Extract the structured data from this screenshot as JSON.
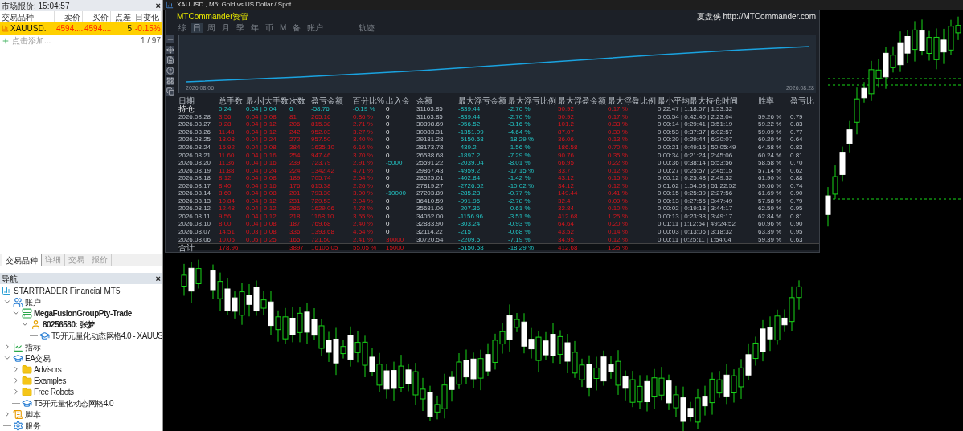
{
  "market_watch": {
    "title": "市场报价: 15:04:57",
    "close": "×",
    "columns": [
      "交易品种",
      "卖价",
      "买价",
      "点差",
      "日变化"
    ],
    "rows": [
      {
        "symbol": "XAUUSD.",
        "bid": "4594....",
        "ask": "4594....",
        "spread": "5",
        "change": "-0.15%",
        "selected": true
      }
    ],
    "add_label": "点击添加...",
    "count": "1 / 97"
  },
  "bottom_tabs": [
    {
      "label": "交易品种",
      "selected": true
    },
    {
      "label": "详细",
      "selected": false
    },
    {
      "label": "交易",
      "selected": false
    },
    {
      "label": "报价",
      "selected": false
    }
  ],
  "navigator": {
    "title": "导航",
    "close": "×",
    "root": "STARTRADER Financial MT5",
    "items": [
      {
        "label": "账户",
        "kind": "accounts",
        "expanded": true,
        "children": [
          {
            "label": "MegaFusionGroupPty-Trade",
            "kind": "server",
            "expanded": true,
            "children": [
              {
                "label": "80256580: 张梦",
                "kind": "user",
                "expanded": true,
                "children": [
                  {
                    "label": "T5开元量化动态网格4.0 - XAUUS",
                    "kind": "ea"
                  }
                ]
              }
            ]
          }
        ]
      },
      {
        "label": "指标",
        "kind": "indicators",
        "expanded": false
      },
      {
        "label": "EA交易",
        "kind": "ea",
        "expanded": true,
        "children": [
          {
            "label": "Advisors",
            "kind": "folder",
            "expanded": false
          },
          {
            "label": "Examples",
            "kind": "folder",
            "expanded": false
          },
          {
            "label": "Free Robots",
            "kind": "folder",
            "expanded": false
          },
          {
            "label": "T5开元量化动态网格4.0",
            "kind": "ea"
          }
        ]
      },
      {
        "label": "脚本",
        "kind": "scripts",
        "expanded": false
      },
      {
        "label": "服务",
        "kind": "services"
      }
    ]
  },
  "chart_window": {
    "title": "XAUUSD., M5: Gold vs US Dollar / Spot"
  },
  "commander": {
    "title": "MTCommander资管",
    "brand": "夏盘侠 http://MTCommander.com",
    "tabs": [
      {
        "label": "综",
        "selected": false
      },
      {
        "label": "日",
        "selected": true
      },
      {
        "label": "周",
        "selected": false
      },
      {
        "label": "月",
        "selected": false
      },
      {
        "label": "季",
        "selected": false
      },
      {
        "label": "年",
        "selected": false
      },
      {
        "label": "币",
        "selected": false
      },
      {
        "label": "M",
        "selected": false
      },
      {
        "label": "备",
        "selected": false
      },
      {
        "label": "账户",
        "selected": false
      },
      {
        "label": "轨迹",
        "selected": false
      }
    ],
    "start_date": "2026.08.06",
    "end_date": "2026.08.28",
    "columns": [
      "日期",
      "总手数",
      "最小|大手数",
      "次数",
      "盈亏金额",
      "百分比%",
      "出入金",
      "余额",
      "最大浮亏金额",
      "最大浮亏比例",
      "最大浮盈金额",
      "最大浮盈比例",
      "最小平均最大持仓时间",
      "胜率",
      "盈亏比"
    ],
    "rows": [
      {
        "kind": "position",
        "d": "持仓",
        "lots": "0.24",
        "mm": "0.04 | 0.04",
        "n": "6",
        "pnl": "-58.76",
        "pct": "-0.19 %",
        "flow": "0",
        "bal": "31163.85",
        "dd": "-839.44",
        "ddp": "-2.70 %",
        "pf": "50.92",
        "pfp": "0.17 %",
        "hold": "0:22:47 | 1:18:07 | 1:53:32"
      },
      {
        "kind": "day",
        "d": "2026.08.28",
        "lots": "3.56",
        "mm": "0.04 | 0.08",
        "n": "81",
        "pnl": "265.16",
        "pct": "0.86 %",
        "flow": "0",
        "bal": "31163.85",
        "dd": "-839.44",
        "ddp": "-2.70 %",
        "pf": "50.92",
        "pfp": "0.17 %",
        "hold": "0:00:54 | 0:42:40 | 2:23:04",
        "win": "59.26 %",
        "plr": "0.79"
      },
      {
        "kind": "day",
        "d": "2026.08.27",
        "lots": "9.28",
        "mm": "0.04 | 0.12",
        "n": "206",
        "pnl": "815.38",
        "pct": "2.71 %",
        "flow": "0",
        "bal": "30898.69",
        "dd": "-956.52",
        "ddp": "-3.16 %",
        "pf": "101.2",
        "pfp": "0.33 %",
        "hold": "0:00:14 | 0:29:41 | 3:51:19",
        "win": "59.22 %",
        "plr": "0.83"
      },
      {
        "kind": "day",
        "d": "2026.08.26",
        "lots": "11.48",
        "mm": "0.04 | 0.12",
        "n": "242",
        "pnl": "952.03",
        "pct": "3.27 %",
        "flow": "0",
        "bal": "30083.31",
        "dd": "-1351.09",
        "ddp": "-4.64 %",
        "pf": "87.07",
        "pfp": "0.30 %",
        "hold": "0:00:53 | 0:37:37 | 6:02:57",
        "win": "59.09 %",
        "plr": "0.77"
      },
      {
        "kind": "day",
        "d": "2026.08.25",
        "lots": "13.08",
        "mm": "0.04 | 0.24",
        "n": "272",
        "pnl": "957.50",
        "pct": "3.40 %",
        "flow": "0",
        "bal": "29131.28",
        "dd": "-5150.58",
        "ddp": "-18.29 %",
        "pf": "36.06",
        "pfp": "0.13 %",
        "hold": "0:00:30 | 0:29:44 | 6:20:07",
        "win": "60.29 %",
        "plr": "0.64"
      },
      {
        "kind": "day",
        "d": "2026.08.24",
        "lots": "15.92",
        "mm": "0.04 | 0.08",
        "n": "384",
        "pnl": "1635.10",
        "pct": "6.16 %",
        "flow": "0",
        "bal": "28173.78",
        "dd": "-439.2",
        "ddp": "-1.56 %",
        "pf": "186.58",
        "pfp": "0.70 %",
        "hold": "0:00:21 | 0:49:16 | 50:05:49",
        "win": "64.58 %",
        "plr": "0.83"
      },
      {
        "kind": "day",
        "d": "2026.08.21",
        "lots": "11.60",
        "mm": "0.04 | 0.16",
        "n": "254",
        "pnl": "947.46",
        "pct": "3.70 %",
        "flow": "0",
        "bal": "26538.68",
        "dd": "-1897.2",
        "ddp": "-7.29 %",
        "pf": "90.76",
        "pfp": "0.35 %",
        "hold": "0:00:34 | 0:21:24 | 2:45:06",
        "win": "60.24 %",
        "plr": "0.81"
      },
      {
        "kind": "day",
        "d": "2026.08.20",
        "lots": "11.36",
        "mm": "0.04 | 0.16",
        "n": "239",
        "pnl": "723.79",
        "pct": "2.91 %",
        "flow": "-5000",
        "bal": "25591.22",
        "dd": "-2039.04",
        "ddp": "-8.01 %",
        "pf": "66.95",
        "pfp": "0.22 %",
        "hold": "0:00:36 | 0:38:14 | 5:53:56",
        "win": "58.58 %",
        "plr": "0.70"
      },
      {
        "kind": "day",
        "d": "2026.08.19",
        "lots": "11.88",
        "mm": "0.04 | 0.24",
        "n": "224",
        "pnl": "1342.42",
        "pct": "4.71 %",
        "flow": "0",
        "bal": "29867.43",
        "dd": "-4959.2",
        "ddp": "-17.15 %",
        "pf": "33.7",
        "pfp": "0.12 %",
        "hold": "0:00:27 | 0:25:57 | 2:45:15",
        "win": "57.14 %",
        "plr": "0.62"
      },
      {
        "kind": "day",
        "d": "2026.08.18",
        "lots": "8.12",
        "mm": "0.04 | 0.08",
        "n": "189",
        "pnl": "705.74",
        "pct": "2.54 %",
        "flow": "0",
        "bal": "28525.01",
        "dd": "-402.84",
        "ddp": "-1.42 %",
        "pf": "43.12",
        "pfp": "0.15 %",
        "hold": "0:00:12 | 0:25:48 | 2:49:32",
        "win": "61.90 %",
        "plr": "0.88"
      },
      {
        "kind": "day",
        "d": "2026.08.17",
        "lots": "8.40",
        "mm": "0.04 | 0.16",
        "n": "176",
        "pnl": "615.38",
        "pct": "2.26 %",
        "flow": "0",
        "bal": "27819.27",
        "dd": "-2726.52",
        "ddp": "-10.02 %",
        "pf": "34.12",
        "pfp": "0.12 %",
        "hold": "0:01:02 | 1:04:03 | 51:22:52",
        "win": "59.66 %",
        "plr": "0.74"
      },
      {
        "kind": "day",
        "d": "2026.08.14",
        "lots": "8.60",
        "mm": "0.04 | 0.08",
        "n": "201",
        "pnl": "793.30",
        "pct": "3.00 %",
        "flow": "-10000",
        "bal": "27203.89",
        "dd": "-285.28",
        "ddp": "-0.77 %",
        "pf": "149.44",
        "pfp": "0.41 %",
        "hold": "0:00:15 | 0:25:39 | 2:27:56",
        "win": "61.69 %",
        "plr": "0.90"
      },
      {
        "kind": "day",
        "d": "2026.08.13",
        "lots": "10.84",
        "mm": "0.04 | 0.12",
        "n": "231",
        "pnl": "729.53",
        "pct": "2.04 %",
        "flow": "0",
        "bal": "36410.59",
        "dd": "-991.96",
        "ddp": "-2.78 %",
        "pf": "32.4",
        "pfp": "0.09 %",
        "hold": "0:00:13 | 0:27:55 | 3:47:49",
        "win": "57.58 %",
        "plr": "0.79"
      },
      {
        "kind": "day",
        "d": "2026.08.12",
        "lots": "12.48",
        "mm": "0.04 | 0.12",
        "n": "286",
        "pnl": "1629.06",
        "pct": "4.78 %",
        "flow": "0",
        "bal": "35681.06",
        "dd": "-207.36",
        "ddp": "-0.61 %",
        "pf": "32.84",
        "pfp": "0.10 %",
        "hold": "0:00:02 | 0:19:13 | 3:44:17",
        "win": "62.59 %",
        "plr": "0.95"
      },
      {
        "kind": "day",
        "d": "2026.08.11",
        "lots": "9.56",
        "mm": "0.04 | 0.12",
        "n": "218",
        "pnl": "1168.10",
        "pct": "3.55 %",
        "flow": "0",
        "bal": "34052.00",
        "dd": "-1156.96",
        "ddp": "-3.51 %",
        "pf": "412.68",
        "pfp": "1.25 %",
        "hold": "0:00:13 | 0:23:38 | 3:49:17",
        "win": "62.84 %",
        "plr": "0.81"
      },
      {
        "kind": "day",
        "d": "2026.08.10",
        "lots": "8.00",
        "mm": "0.04 | 0.08",
        "n": "187",
        "pnl": "769.68",
        "pct": "2.40 %",
        "flow": "0",
        "bal": "32883.90",
        "dd": "-303.24",
        "ddp": "-0.93 %",
        "pf": "64.64",
        "pfp": "0.20 %",
        "hold": "0:01:11 | 1:12:54 | 49:24:52",
        "win": "60.96 %",
        "plr": "0.90"
      },
      {
        "kind": "day",
        "d": "2026.08.07",
        "lots": "14.51",
        "mm": "0.03 | 0.08",
        "n": "336",
        "pnl": "1393.68",
        "pct": "4.54 %",
        "flow": "0",
        "bal": "32114.22",
        "dd": "-215",
        "ddp": "-0.68 %",
        "pf": "43.52",
        "pfp": "0.14 %",
        "hold": "0:00:03 | 0:13:06 | 3:18:32",
        "win": "63.39 %",
        "plr": "0.95"
      },
      {
        "kind": "day",
        "d": "2026.08.06",
        "lots": "10.05",
        "mm": "0.05 | 0.25",
        "n": "165",
        "pnl": "721.50",
        "pct": "2.41 %",
        "flow": "30000",
        "bal": "30720.54",
        "dd": "-2209.5",
        "ddp": "-7.19 %",
        "pf": "34.95",
        "pfp": "0.12 %",
        "hold": "0:00:11 | 0:25:11 | 1:54:04",
        "win": "59.39 %",
        "plr": "0.63"
      },
      {
        "kind": "total",
        "d": "合计",
        "lots": "178.96",
        "n": "3897",
        "pnl": "16106.05",
        "pct": "55.05 %",
        "flow": "15000",
        "dd": "-5150.58",
        "ddp": "-18.29 %",
        "pf": "412.68",
        "pfp": "1.25 %"
      }
    ]
  }
}
